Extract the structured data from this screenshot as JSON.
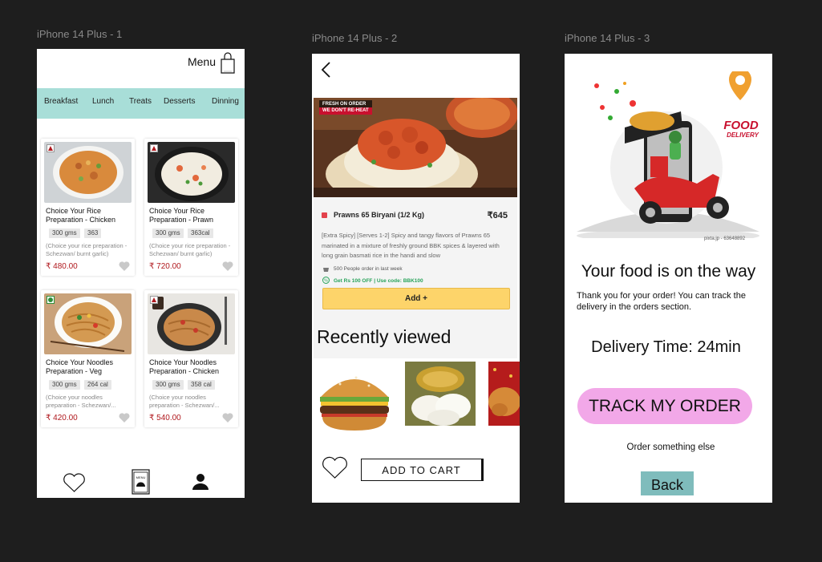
{
  "frames": [
    "iPhone 14 Plus - 1",
    "iPhone 14 Plus - 2",
    "iPhone 14 Plus - 3"
  ],
  "screen1": {
    "header_title": "Menu",
    "tabs": [
      "Breakfast",
      "Lunch",
      "Treats",
      "Desserts",
      "Dinning"
    ],
    "cards": [
      {
        "title": "Choice Your Rice Preparation - Chicken",
        "qty": "300 gms",
        "cal": "363",
        "desc": "(Choice your rice preparation - Schezwan/ burnt garlic)",
        "price": "₹ 480.00",
        "veg": false
      },
      {
        "title": "Choice Your Rice Preparation - Prawn",
        "qty": "300 gms",
        "cal": "363cal",
        "desc": "(Choice your rice preparation - Schezwan/ burnt garlic)",
        "price": "₹ 720.00",
        "veg": false
      },
      {
        "title": "Choice Your Noodles Preparation - Veg",
        "qty": "300 gms",
        "cal": "264 cal",
        "desc": "(Choice your noodles preparation - Schezwan/...",
        "price": "₹ 420.00",
        "veg": true
      },
      {
        "title": "Choice Your Noodles Preparation - Chicken",
        "qty": "300 gms",
        "cal": "358 cal",
        "desc": "(Choice your noodles preparation - Schezwan/...",
        "price": "₹ 540.00",
        "veg": false
      }
    ],
    "nav_icons": [
      "heart-icon",
      "menu-book-icon",
      "user-icon"
    ]
  },
  "screen2": {
    "badge_line1": "FRESH ON ORDER",
    "badge_line2": "WE DON'T RE-HEAT",
    "product_name": "Prawns 65 Biryani (1/2 Kg)",
    "product_price": "₹645",
    "product_desc": "[Extra Spicy] [Serves 1-2] Spicy and tangy flavors of Prawns 65 marinated in a mixture of freshly ground BBK spices & layered with long grain basmati rice in the handi and slow",
    "orders_text": "500 People order in last week",
    "coupon_text": "Get Rs 100 OFF | Use code: BBK100",
    "add_label": "Add +",
    "recent_title": "Recently viewed",
    "cart_label": "ADD TO CART"
  },
  "screen3": {
    "logo_line1": "FOOD",
    "logo_line2": "DELIVERY",
    "stock_credit": "pixta.jp - 63648892",
    "title": "Your food is on the way",
    "message": "Thank you for your order!  You can track the delivery in the orders section.",
    "delivery_time": "Delivery Time: 24min",
    "track_label": "TRACK MY ORDER",
    "order_else": "Order something else",
    "back_label": "Back"
  },
  "colors": {
    "tab_bar": "#a8ded8",
    "price": "#b0191e",
    "add_button": "#fdd46a",
    "track_button": "#f2a8e8",
    "back_button": "#7fbcbc"
  }
}
